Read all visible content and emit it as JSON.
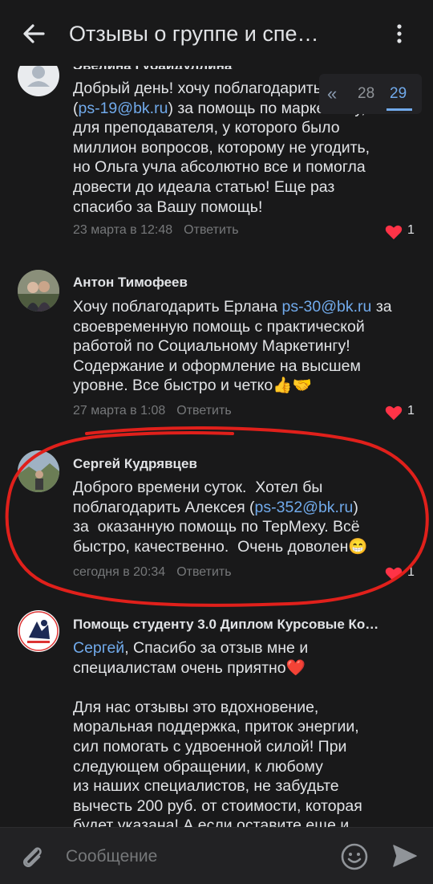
{
  "header": {
    "title": "Отзывы о группе и спе…"
  },
  "pager": {
    "prev": "«",
    "pages": [
      "28",
      "29"
    ]
  },
  "comments": [
    {
      "author": "Эвелина Губаидуллина",
      "text_a": "Добрый день! хочу поблагодарить Ольгу\n(",
      "link": "ps-19@bk.ru",
      "text_b": ") за помощь по маркетингу,\nдля преподавателя, у которого было\nмиллион вопросов, которому не угодить,\nно Ольга учла абсолютно все и помогла\nдовести до идеала статью! Еще раз\nспасибо за Вашу помощь!",
      "date": "23 марта в 12:48",
      "reply": "Ответить",
      "likes": "1"
    },
    {
      "author": "Антон Тимофеев",
      "text_a": "Хочу поблагодарить Ерлана ",
      "link": "ps-30@bk.ru",
      "text_b": " за\nсвоевременную помощь с практической\nработой по Социальному Маркетингу!\nСодержание и оформление на высшем\nуровне. Все быстро и четко👍🤝",
      "date": "27 марта в 1:08",
      "reply": "Ответить",
      "likes": "1"
    },
    {
      "author": "Сергей Кудрявцев",
      "text_a": "Доброго времени суток.  Хотел бы\nпоблагодарить Алексея (",
      "link": "ps-352@bk.ru",
      "text_b": ")\nза  оказанную помощь по ТерМеху. Всё\nбыстро, качественно.  Очень доволен😁",
      "date": "сегодня в 20:34",
      "reply": "Ответить",
      "likes": "1"
    },
    {
      "author": "Помощь студенту 3.0 Диплом Курсовые Ко…",
      "mention": "Сергей",
      "text_b": ", Спасибо за отзыв мне и\nспециалистам очень приятно❤️\n\nДля нас отзывы это вдохновение,\nморальная поддержка, приток энергии,\nсил помогать с удвоенной силой! При\nследующем обращении, к любому\nиз наших специалистов, не забудьте\nвычесть 200 руб. от стоимости, которая\nбудет указана! А если оставите еще и"
    }
  ],
  "composer": {
    "placeholder": "Сообщение"
  },
  "colors": {
    "background": "#19191a",
    "link": "#71aaeb",
    "like": "#ff3347",
    "annotation": "#e0201b"
  },
  "icons": [
    "back-arrow-icon",
    "more-vertical-icon",
    "heart-icon",
    "attach-icon",
    "emoji-icon",
    "send-icon"
  ]
}
